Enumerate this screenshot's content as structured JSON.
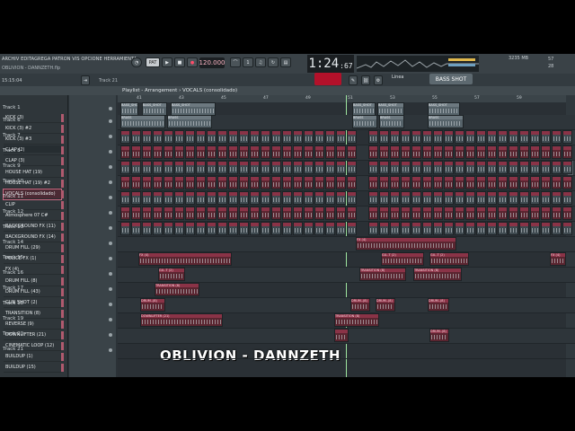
{
  "menu": {
    "text": "ARCHIV EDITAGREGA PATRON VIS OPCIONE HERRAMIENTA"
  },
  "song": {
    "filename": "OBLIVION - DANNZETH.flp",
    "clock": "15:15:04"
  },
  "transport": {
    "tempo": "120.000",
    "time_main": "1:24",
    "time_sub": ":67"
  },
  "system": {
    "memory": "3235 MB",
    "cpu": "57",
    "cpu2": "28"
  },
  "snap": {
    "label": "Linea"
  },
  "pattern": {
    "label": "BASS SHOT"
  },
  "playlist": {
    "title": "Playlist - Arrangement › VOCALS  (consolidado)",
    "current_track": "Track 21"
  },
  "channels": [
    "KICK (3)",
    "KICK (3) #2",
    "KICK (3) #3",
    "CLAP (2)",
    "CLAP (3)",
    "HOUSE HAT (19)",
    "HOUSE HAT (19) #2",
    "VOCALS  (consolidado)",
    "CLIP",
    "Atmosphere 07 C#",
    "BACKGROUND FX (11)",
    "BACKGROUND FX (14)",
    "DRUM FILL (29)",
    "POLICE FX (1)",
    "FX (4)",
    "DRUM FILL (8)",
    "DRUM FILL (43)",
    "GUN SHOT (2)",
    "TRANSITION (8)",
    "REVERSE (9)",
    "DOWNLIFTER (21)",
    "CINEMATIC LOOP (12)",
    "BUILDUP (1)",
    "BUILDUP (15)"
  ],
  "tracks": [
    "Track 1",
    "Track 6",
    "Track 7",
    "Track 8",
    "Track 9",
    "Track 10",
    "Track 11",
    "Track 12",
    "Track 13",
    "Track 14",
    "Track 15",
    "Track 16",
    "Track 17",
    "Track 18",
    "Track 19",
    "Track 20",
    "Track 21"
  ],
  "ruler": [
    "41",
    "43",
    "45",
    "47",
    "49",
    "51",
    "53",
    "55",
    "57",
    "59"
  ],
  "clips": {
    "bass_shot": "BASS_SHOT",
    "brass": "BRASS",
    "fx": "FX (4)",
    "gs": "GU..T (2)",
    "transition": "TRANSITION (8)",
    "drum": "DRUM..(8)",
    "downlifter": "DOWNLIFTER (21)"
  },
  "overlay": {
    "title": "OBLIVION - DANNZETH"
  }
}
